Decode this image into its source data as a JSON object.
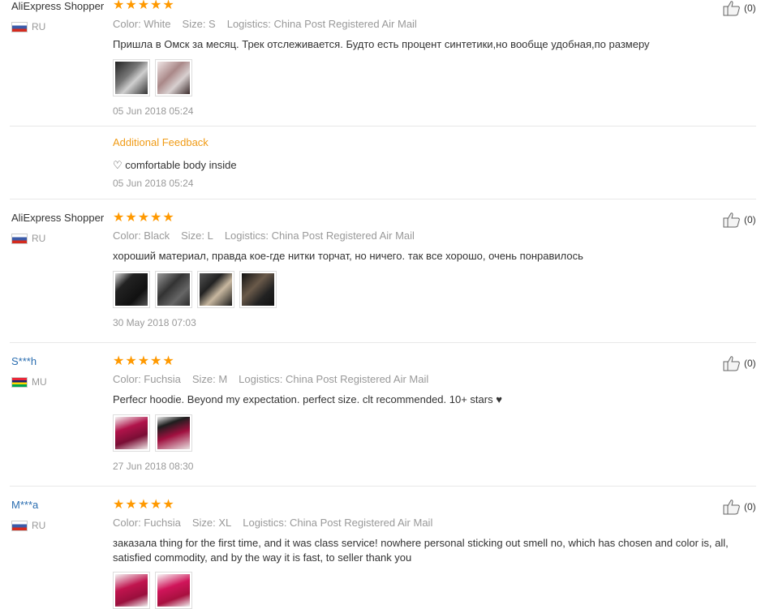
{
  "reviews": [
    {
      "user": "AliExpress Shopper",
      "country": "RU",
      "flag": "ru",
      "rating": 5,
      "attributes": {
        "color": "Color: White",
        "size": "Size: S",
        "logistics": "Logistics: China Post Registered Air Mail"
      },
      "text": "Пришла в Омск за месяц. Трек отслеживается. Будто есть процент синтетики,но вообще удобная,по размеру",
      "photos": [
        "photo-1",
        "photo-2"
      ],
      "date": "05 Jun 2018 05:24",
      "likes": "(0)",
      "additional": {
        "title": "Additional Feedback",
        "text": "♡ comfortable body inside",
        "date": "05 Jun 2018 05:24"
      }
    },
    {
      "user": "AliExpress Shopper",
      "country": "RU",
      "flag": "ru",
      "rating": 5,
      "attributes": {
        "color": "Color: Black",
        "size": "Size: L",
        "logistics": "Logistics: China Post Registered Air Mail"
      },
      "text": "хороший материал, правда кое-где нитки торчат, но ничего. так все хорошо, очень понравилось",
      "photos": [
        "photo-1",
        "photo-2",
        "photo-3",
        "photo-4"
      ],
      "date": "30 May 2018 07:03",
      "likes": "(0)"
    },
    {
      "user": "S***h",
      "country": "MU",
      "flag": "mu",
      "rating": 5,
      "attributes": {
        "color": "Color: Fuchsia",
        "size": "Size: M",
        "logistics": "Logistics: China Post Registered Air Mail"
      },
      "text": "Perfecr hoodie. Beyond my expectation. perfect size. clt recommended. 10+ stars ♥",
      "photos": [
        "photo-1",
        "photo-2"
      ],
      "date": "27 Jun 2018 08:30",
      "likes": "(0)"
    },
    {
      "user": "M***a",
      "country": "RU",
      "flag": "ru",
      "rating": 5,
      "attributes": {
        "color": "Color: Fuchsia",
        "size": "Size: XL",
        "logistics": "Logistics: China Post Registered Air Mail"
      },
      "text": "заказала thing for the first time, and it was class service! nowhere personal sticking out smell no, which has chosen and color is, all, satisfied commodity, and by the way it is fast, to seller thank you",
      "photos": [
        "photo-1",
        "photo-2"
      ],
      "likes": "(0)"
    }
  ],
  "colors": {
    "star": "#ff9900",
    "accent": "#f09b16",
    "link": "#2a6db0",
    "muted": "#999999"
  },
  "icons": {
    "star": "star-icon",
    "like": "thumbs-up-icon"
  }
}
